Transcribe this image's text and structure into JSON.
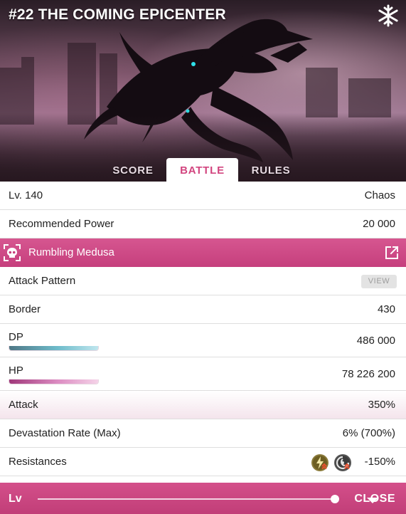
{
  "hero": {
    "title": "#22 THE COMING EPICENTER",
    "element_icon": "snowflake-icon"
  },
  "tabs": [
    {
      "label": "SCORE",
      "active": false
    },
    {
      "label": "BATTLE",
      "active": true
    },
    {
      "label": "RULES",
      "active": false
    }
  ],
  "battle": {
    "level_label": "Lv. 140",
    "difficulty": "Chaos",
    "recommended_power_label": "Recommended Power",
    "recommended_power": "20 000",
    "enemy_name": "Rumbling Medusa",
    "attack_pattern_label": "Attack Pattern",
    "view_button": "VIEW",
    "border_label": "Border",
    "border": "430",
    "dp_label": "DP",
    "dp": "486 000",
    "dp_gauge_fraction": 1.0,
    "hp_label": "HP",
    "hp": "78 226 200",
    "hp_gauge_fraction": 1.0,
    "attack_label": "Attack",
    "attack": "350%",
    "devastation_label": "Devastation Rate (Max)",
    "devastation": "6% (700%)",
    "resistances_label": "Resistances",
    "resistances_value": "-150%",
    "resistance_icons": [
      "lightning-resist-icon",
      "wind-resist-icon"
    ]
  },
  "footer": {
    "lv_label": "Lv",
    "close_label": "CLOSE",
    "level_slider_fraction": 1.0
  },
  "colors": {
    "accent_pink": "#c9447f",
    "tab_active_text": "#d2457f",
    "dp_gauge": "#6fbccb",
    "hp_gauge": "#dc8cc2"
  }
}
